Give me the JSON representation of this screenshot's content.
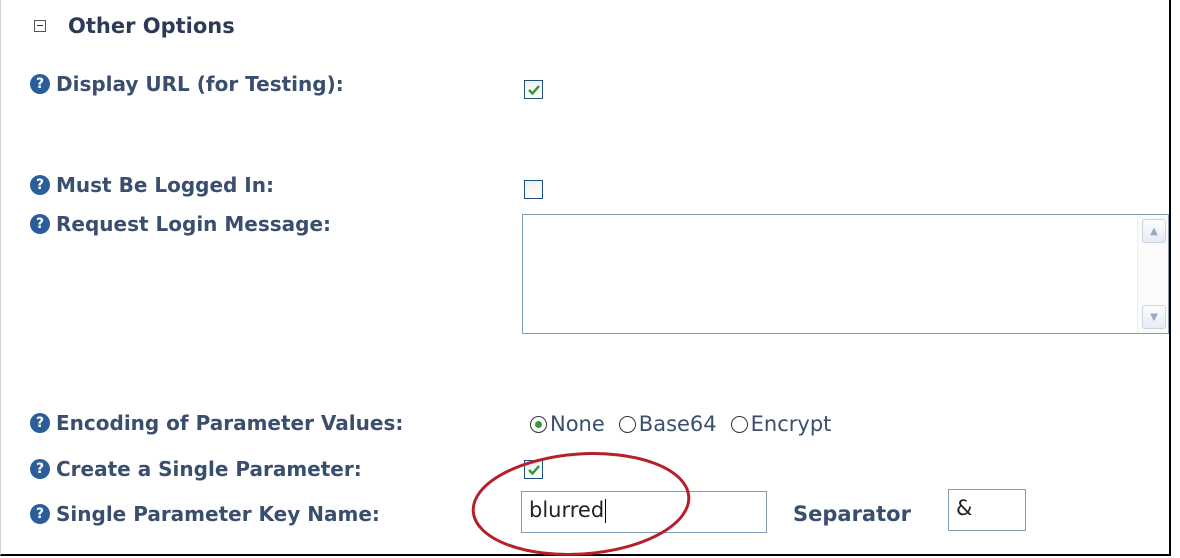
{
  "section": {
    "title": "Other Options",
    "help_glyph": "?"
  },
  "fields": {
    "display_url": {
      "label": "Display URL (for Testing):",
      "checked": true
    },
    "must_be_logged_in": {
      "label": "Must Be Logged In:",
      "checked": false
    },
    "request_login_message": {
      "label": "Request Login Message:",
      "value": ""
    },
    "encoding": {
      "label": "Encoding of Parameter Values:",
      "options": [
        "None",
        "Base64",
        "Encrypt"
      ],
      "selected": "None"
    },
    "create_single_parameter": {
      "label": "Create a Single Parameter:",
      "checked": true
    },
    "single_parameter_key_name": {
      "label": "Single Parameter Key Name:",
      "value": "blurred"
    },
    "separator": {
      "label": "Separator",
      "value": "&"
    }
  },
  "colors": {
    "annotation_ellipse": "#b5212a",
    "check_mark": "#2e9a2e",
    "help_icon": "#2b5d9a"
  },
  "icons": {
    "collapse": "minus-box-icon",
    "help": "question-circle-icon",
    "scroll_up": "arrow-up-icon",
    "scroll_down": "arrow-down-icon"
  }
}
